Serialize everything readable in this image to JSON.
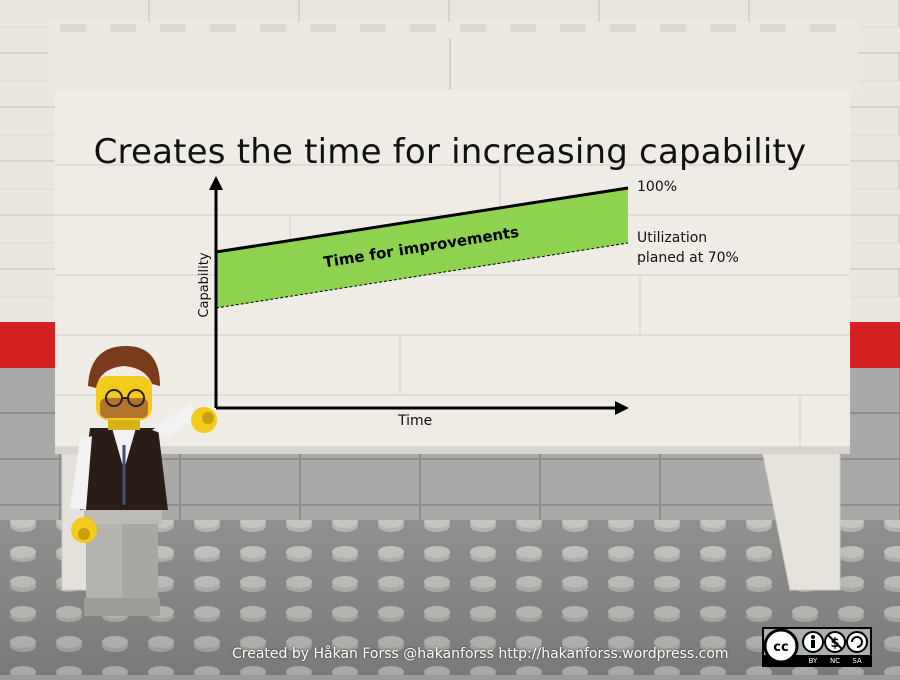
{
  "slide": {
    "title": "Creates the time for increasing capability",
    "label_100": "100%",
    "utilization_line1": "Utilization",
    "utilization_line2": "planed at 70%",
    "band_label": "Time for improvements",
    "y_axis_label": "Capability",
    "x_axis_label": "Time",
    "credit": "Created by Håkan Forss @hakanforss http://hakanforss.wordpress.com"
  },
  "license": {
    "icon": "creative-commons-by-nc-sa-icon",
    "cc": "cc",
    "by": "BY",
    "nc": "NC",
    "sa": "SA"
  },
  "colors": {
    "band_green": "#8ed34f",
    "board_white": "#ebe8e2",
    "stripe_red": "#d42020",
    "baseplate_grey": "#9a9a98"
  }
}
